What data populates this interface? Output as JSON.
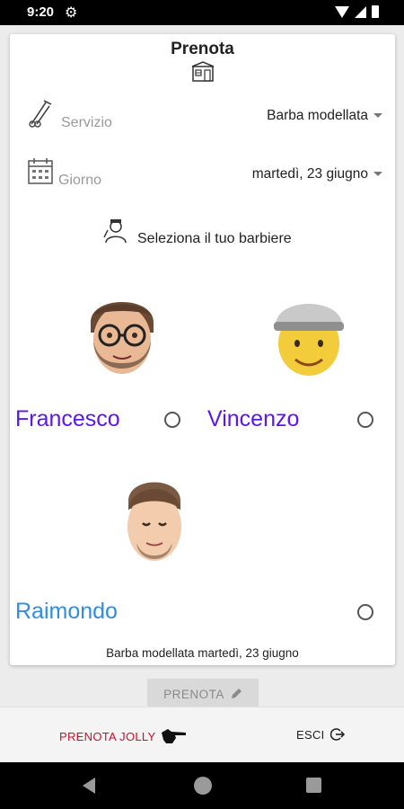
{
  "status_bar": {
    "time": "9:20"
  },
  "card": {
    "title": "Prenota",
    "servizio": {
      "label": "Servizio",
      "value": "Barba modellata"
    },
    "giorno": {
      "label": "Giorno",
      "value": "martedì, 23 giugno"
    },
    "barber_section_title": "Seleziona il tuo barbiere",
    "barbers": [
      {
        "name": "Francesco",
        "color": "#5b19e6"
      },
      {
        "name": "Vincenzo",
        "color": "#5b19e6"
      },
      {
        "name": "Raimondo",
        "color": "#2f8de3"
      }
    ],
    "summary": "Barba modellata martedì, 23 giugno"
  },
  "prenota_button": {
    "label": "PRENOTA",
    "icon": "pencil-icon"
  },
  "bottom_bar": {
    "jolly_label": "PRENOTA JOLLY",
    "jolly_icon": "pointing-hand-icon",
    "esci_label": "ESCI",
    "esci_icon": "logout-icon"
  },
  "colors": {
    "accent_red": "#c4122e",
    "name_purple": "#5b19e6",
    "name_blue": "#2f8de3"
  }
}
